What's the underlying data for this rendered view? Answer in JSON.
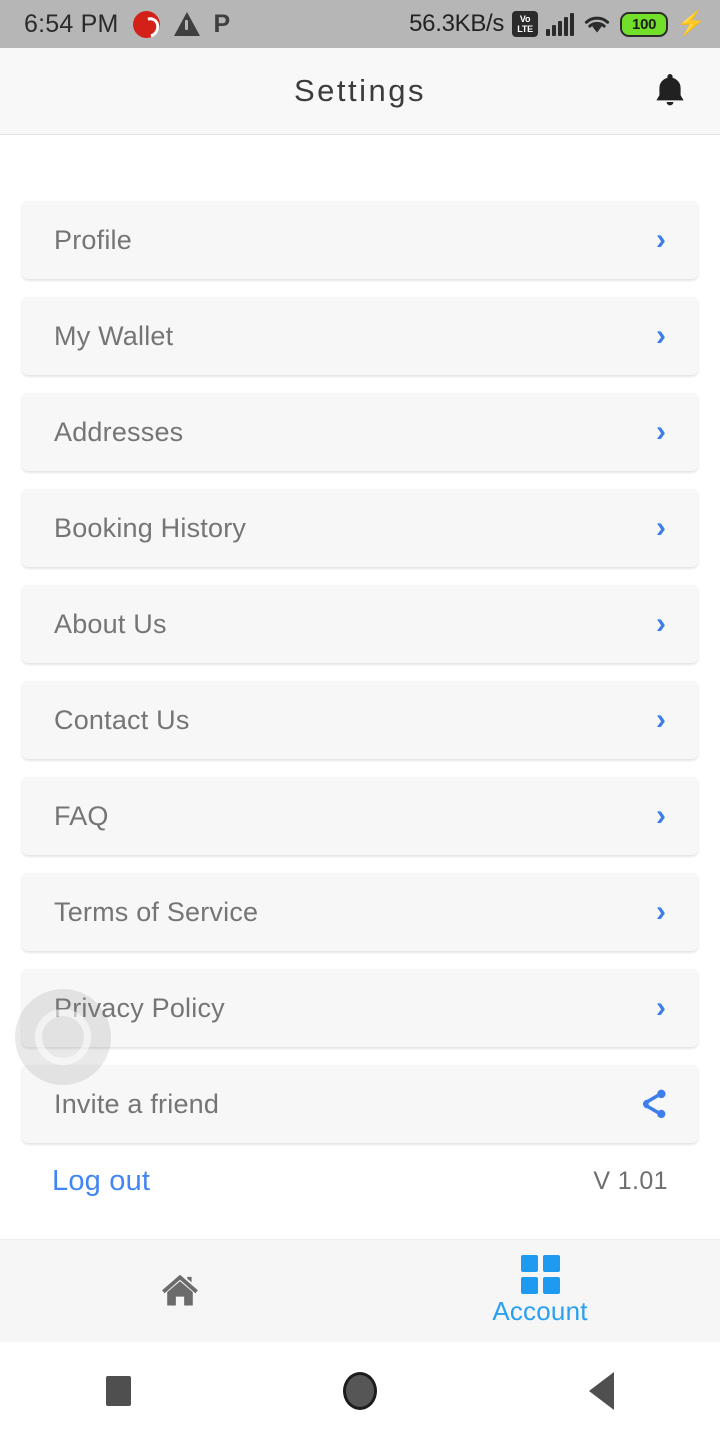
{
  "status_bar": {
    "time": "6:54 PM",
    "carrier_icon": "airtel-logo-icon",
    "warning_icon": "warning-triangle-icon",
    "parking_icon": "letter-p-icon",
    "network_speed": "56.3KB/s",
    "volte_top": "Vo",
    "volte_bottom": "LTE",
    "signal_icon": "signal-bars-icon",
    "wifi_icon": "wifi-icon",
    "battery_level": "100",
    "charging_icon": "lightning-bolt-icon"
  },
  "header": {
    "title": "Settings",
    "notification_icon": "bell-icon"
  },
  "settings_list": [
    {
      "label": "Profile",
      "accessory": "chevron-right-icon",
      "chevron": "›"
    },
    {
      "label": "My Wallet",
      "accessory": "chevron-right-icon",
      "chevron": "›"
    },
    {
      "label": "Addresses",
      "accessory": "chevron-right-icon",
      "chevron": "›"
    },
    {
      "label": "Booking History",
      "accessory": "chevron-right-icon",
      "chevron": "›"
    },
    {
      "label": "About Us",
      "accessory": "chevron-right-icon",
      "chevron": "›"
    },
    {
      "label": "Contact Us",
      "accessory": "chevron-right-icon",
      "chevron": "›"
    },
    {
      "label": "FAQ",
      "accessory": "chevron-right-icon",
      "chevron": "›"
    },
    {
      "label": "Terms of Service",
      "accessory": "chevron-right-icon",
      "chevron": "›"
    },
    {
      "label": "Privacy Policy",
      "accessory": "chevron-right-icon",
      "chevron": "›"
    },
    {
      "label": "Invite a friend",
      "accessory": "share-icon",
      "chevron": ""
    }
  ],
  "footer": {
    "logout_label": "Log out",
    "version_label": "V 1.01"
  },
  "overlay": {
    "assistive_touch_icon": "assistive-touch-floating-button"
  },
  "tabbar": {
    "tabs": [
      {
        "icon": "home-icon",
        "label": "",
        "active": false
      },
      {
        "icon": "grid-icon",
        "label": "Account",
        "active": true
      }
    ]
  },
  "system_nav": {
    "recents_icon": "square-recents-icon",
    "home_icon": "circle-home-icon",
    "back_icon": "triangle-back-icon"
  },
  "colors": {
    "accent_blue": "#3d7eeb",
    "tab_blue": "#1e9bf0",
    "logout_blue": "#4285f4",
    "label_gray": "#757575",
    "card_bg": "#f7f7f7",
    "statusbar_bg": "#b6b6b6"
  }
}
